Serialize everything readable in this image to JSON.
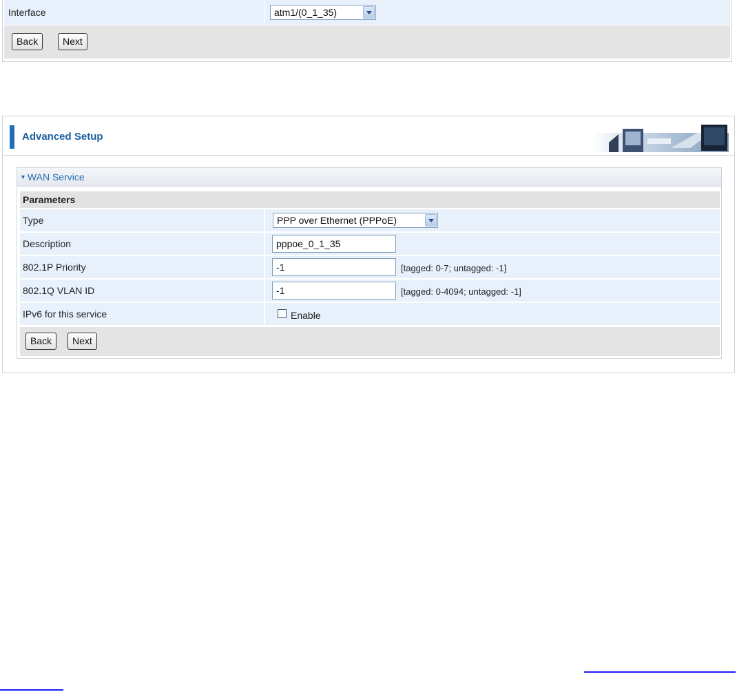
{
  "top_panel": {
    "interface_label": "Interface",
    "interface_value": "atm1/(0_1_35)",
    "back_label": "Back",
    "next_label": "Next"
  },
  "main_panel": {
    "title": "Advanced Setup",
    "section_title": "WAN Service",
    "params_header": "Parameters",
    "rows": {
      "type": {
        "label": "Type",
        "value": "PPP over Ethernet (PPPoE)"
      },
      "description": {
        "label": "Description",
        "value": "pppoe_0_1_35"
      },
      "priority": {
        "label": "802.1P Priority",
        "value": "-1",
        "hint": "[tagged: 0-7; untagged: -1]"
      },
      "vlan": {
        "label": "802.1Q VLAN ID",
        "value": "-1",
        "hint": "[tagged: 0-4094; untagged: -1]"
      },
      "ipv6": {
        "label": "IPv6 for this service",
        "checkbox_label": "Enable"
      }
    },
    "back_label": "Back",
    "next_label": "Next"
  },
  "colors": {
    "accent": "#1e6fb8",
    "title_text": "#1b5f9e",
    "row_bg": "#e8f1fb",
    "button_row_bg": "#e4e4e4",
    "link": "#1a1aff"
  }
}
